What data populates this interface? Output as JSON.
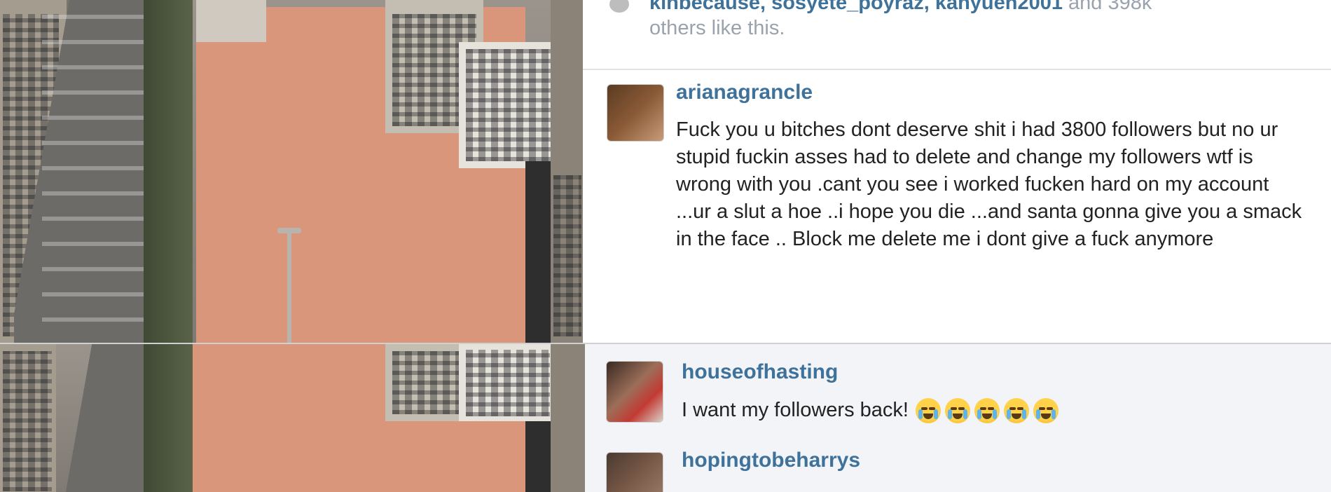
{
  "likes": {
    "names": "kinbecause, sosyete_poyraz, kahyuen2001",
    "suffix": " and 398k",
    "line2": "others like this."
  },
  "comments": [
    {
      "username": "arianagrancle",
      "text": "Fuck you u bitches dont deserve shit i had 3800 followers but no ur stupid fuckin asses had to delete and change my followers wtf is wrong with you .cant you see i worked fucken hard on my account ...ur a slut a hoe ..i hope you die ...and santa gonna give you a smack in the face .. Block me delete me i dont give a fuck anymore"
    },
    {
      "username": "houseofhasting",
      "text": "I want my followers back!",
      "emoji": [
        "crying-face",
        "crying-face",
        "crying-face",
        "crying-face",
        "crying-face"
      ]
    },
    {
      "username": "hopingtobeharrys",
      "text": ""
    }
  ],
  "colors": {
    "username": "#3f729b",
    "like_text": "#9aa3ad",
    "comment_text": "#222222"
  }
}
